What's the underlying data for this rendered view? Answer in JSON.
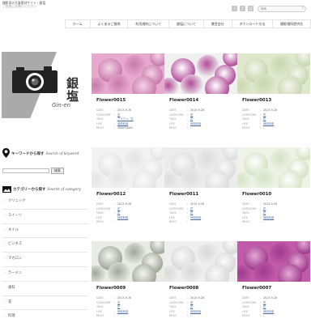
{
  "site": {
    "tagline": "撮影用の写真素材サイト｜銀塩",
    "subtagline": "ご自由にお使いください",
    "logo_kanji": "銀\n塩",
    "logo_roman": "Gin-en"
  },
  "header": {
    "social": [
      "f",
      "t",
      "g"
    ],
    "search_placeholder": "検索"
  },
  "nav": [
    "ホーム",
    "よくあるご質問",
    "利用規約について",
    "銀塩について",
    "運営会社",
    "ダウンロード方法",
    "撮影場所提供先"
  ],
  "sidebar": {
    "keyword_title": "キーワードから探す",
    "keyword_script": "Search of keyword",
    "keyword_button": "検索",
    "category_title": "カテゴリーから探す",
    "category_script": "Search of category",
    "categories": [
      "クリニック",
      "スイーツ",
      "ネイル",
      "ビジネス",
      "マカロン",
      "ラーメン",
      "歯科",
      "花",
      "料理",
      "料理"
    ]
  },
  "photos": [
    {
      "title": "Flower0015",
      "date": "2013-9-28",
      "category": "花",
      "tags": "ブラウン、花",
      "use": "商用利用",
      "free": "3000*2000",
      "colors": [
        "#e8a9cf",
        "#c77aa8",
        "#f3d2e6"
      ]
    },
    {
      "title": "Flower0014",
      "date": "2013-9-28",
      "category": "花",
      "tags": "花",
      "use": "商用利用",
      "free": "-",
      "colors": [
        "#f0f0f0",
        "#b24b99",
        "#ffffff"
      ]
    },
    {
      "title": "Flower0013",
      "date": "2013-9-28",
      "category": "花",
      "tags": "花",
      "use": "商用利用",
      "free": "-",
      "colors": [
        "#dfe8cc",
        "#c9d6ae",
        "#f4f6ee"
      ]
    },
    {
      "title": "Flower0012",
      "date": "2013-9-28",
      "category": "花",
      "tags": "花",
      "use": "商用利用",
      "free": "-",
      "colors": [
        "#f2f2f2",
        "#e4e4e4",
        "#fafafa"
      ]
    },
    {
      "title": "Flower0011",
      "date": "2013-9-28",
      "category": "花",
      "tags": "花",
      "use": "商用利用",
      "free": "-",
      "colors": [
        "#ececec",
        "#dcdcdc",
        "#f9f9f9"
      ]
    },
    {
      "title": "Flower0010",
      "date": "2013-9-28",
      "category": "花",
      "tags": "花",
      "use": "商用利用",
      "free": "-",
      "colors": [
        "#eef3e6",
        "#d5e2c4",
        "#ffffff"
      ]
    },
    {
      "title": "Flower0009",
      "date": "2013-9-28",
      "category": "花",
      "tags": "花",
      "use": "商用利用",
      "free": "-",
      "colors": [
        "#e9ebe5",
        "#9fa79a",
        "#f6f6f2"
      ]
    },
    {
      "title": "Flower0008",
      "date": "2013-9-28",
      "category": "花",
      "tags": "花",
      "use": "商用利用",
      "free": "-",
      "colors": [
        "#efefef",
        "#d8d8d8",
        "#fafafa"
      ]
    },
    {
      "title": "Flower0007",
      "date": "2013-9-28",
      "category": "花",
      "tags": "花",
      "use": "商用利用",
      "free": "-",
      "colors": [
        "#c15aa8",
        "#9c3c8c",
        "#e7a7d6"
      ]
    }
  ],
  "meta_labels": {
    "date": "DATE",
    "category": "CATEGORY",
    "tags": "TAGS",
    "use": "LIFE",
    "free": "RESO"
  },
  "meta_sep": ":"
}
